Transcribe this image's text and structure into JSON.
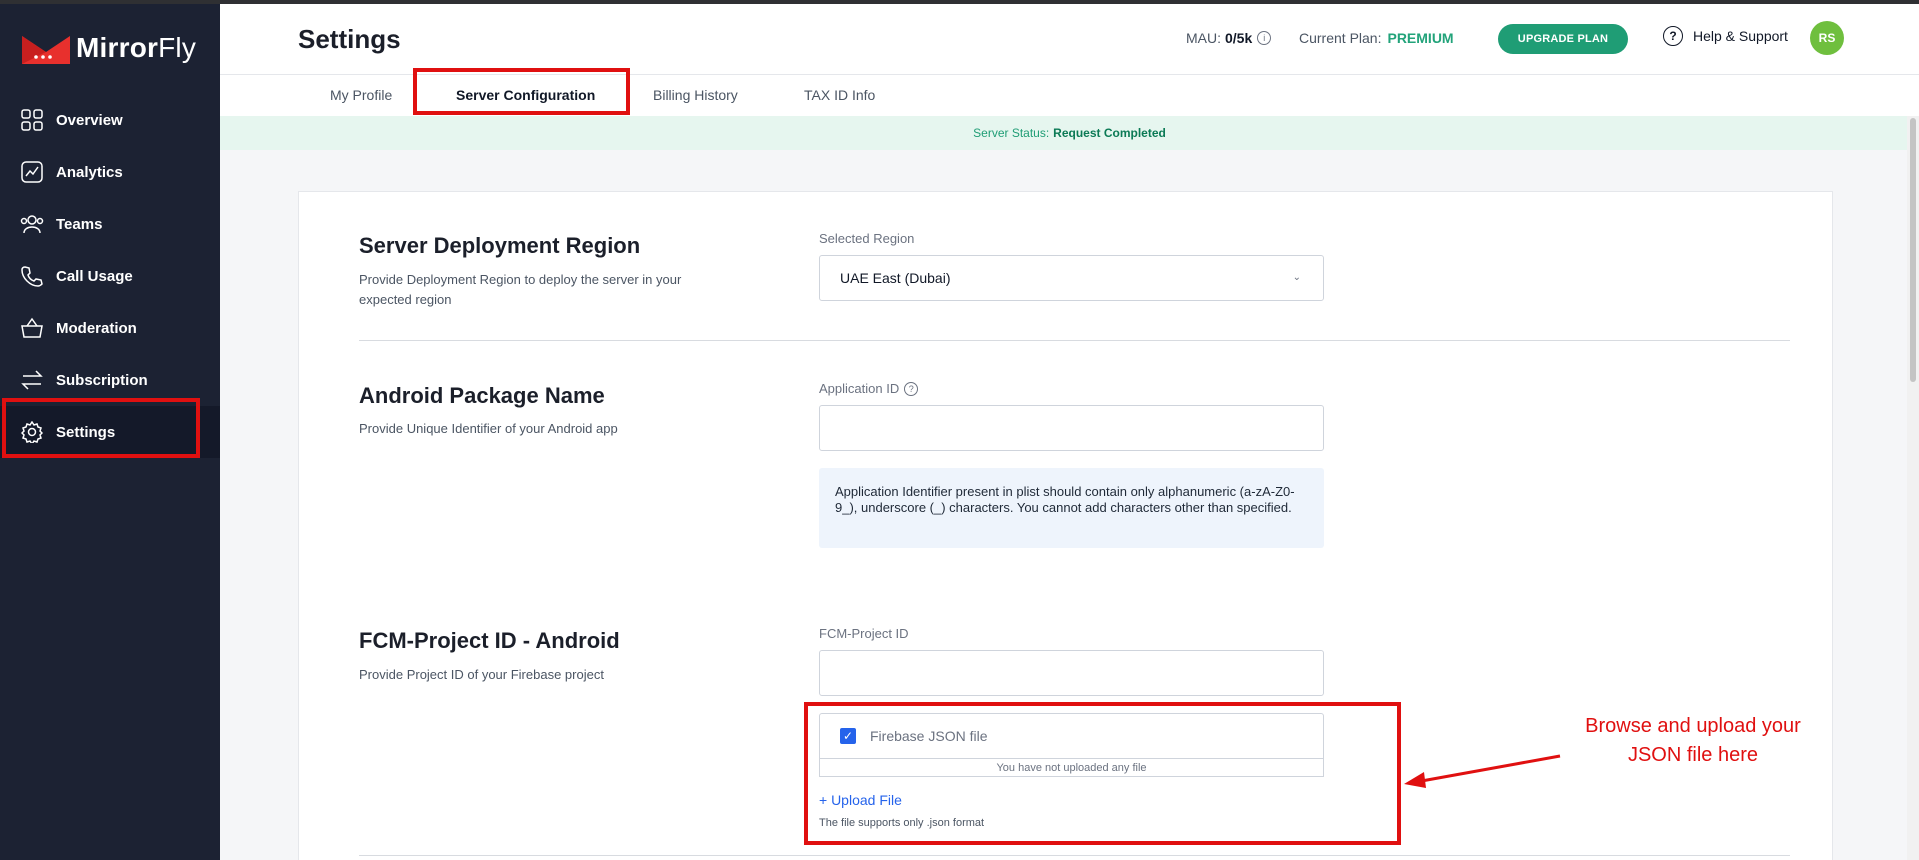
{
  "app": {
    "logo_bold": "Mirror",
    "logo_regular": "Fly"
  },
  "sidebar": {
    "items": [
      {
        "label": "Overview",
        "icon": "grid-icon"
      },
      {
        "label": "Analytics",
        "icon": "analytics-icon"
      },
      {
        "label": "Teams",
        "icon": "teams-icon"
      },
      {
        "label": "Call Usage",
        "icon": "phone-icon"
      },
      {
        "label": "Moderation",
        "icon": "basket-icon"
      },
      {
        "label": "Subscription",
        "icon": "swap-arrows-icon"
      },
      {
        "label": "Settings",
        "icon": "gear-icon",
        "active": true
      }
    ]
  },
  "header": {
    "title": "Settings",
    "mau_label": "MAU:",
    "mau_value": "0/5k",
    "plan_label": "Current Plan:",
    "plan_value": "PREMIUM",
    "upgrade_label": "UPGRADE PLAN",
    "help_label": "Help & Support",
    "avatar_initials": "RS"
  },
  "tabs": [
    {
      "label": "My Profile"
    },
    {
      "label": "Server Configuration",
      "active": true
    },
    {
      "label": "Billing History"
    },
    {
      "label": "TAX ID Info"
    }
  ],
  "status": {
    "label": "Server Status:",
    "value": "Request Completed"
  },
  "sections": {
    "region": {
      "title": "Server Deployment Region",
      "desc": "Provide Deployment Region to deploy the server in your expected region",
      "field_label": "Selected Region",
      "value": "UAE East (Dubai)"
    },
    "android": {
      "title": "Android Package Name",
      "desc": "Provide Unique Identifier of your Android app",
      "field_label": "Application ID",
      "value": "",
      "note": "Application Identifier present in plist should contain only alphanumeric (a-zA-Z0-9_), underscore (_) characters. You cannot add characters other than specified."
    },
    "fcm": {
      "title": "FCM-Project ID - Android",
      "desc": "Provide Project ID of your Firebase project",
      "field_label": "FCM-Project ID",
      "value": "",
      "file_label": "Firebase JSON file",
      "file_status": "You have not uploaded any file",
      "upload_label": "+ Upload File",
      "hint": "The file supports only .json format"
    }
  },
  "annotation": {
    "text": "Browse and upload your JSON file here",
    "color": "#e01010"
  },
  "colors": {
    "sidebar_bg": "#1c2233",
    "accent_green": "#1f9d75",
    "highlight_red": "#e01010",
    "link_blue": "#2563eb"
  }
}
